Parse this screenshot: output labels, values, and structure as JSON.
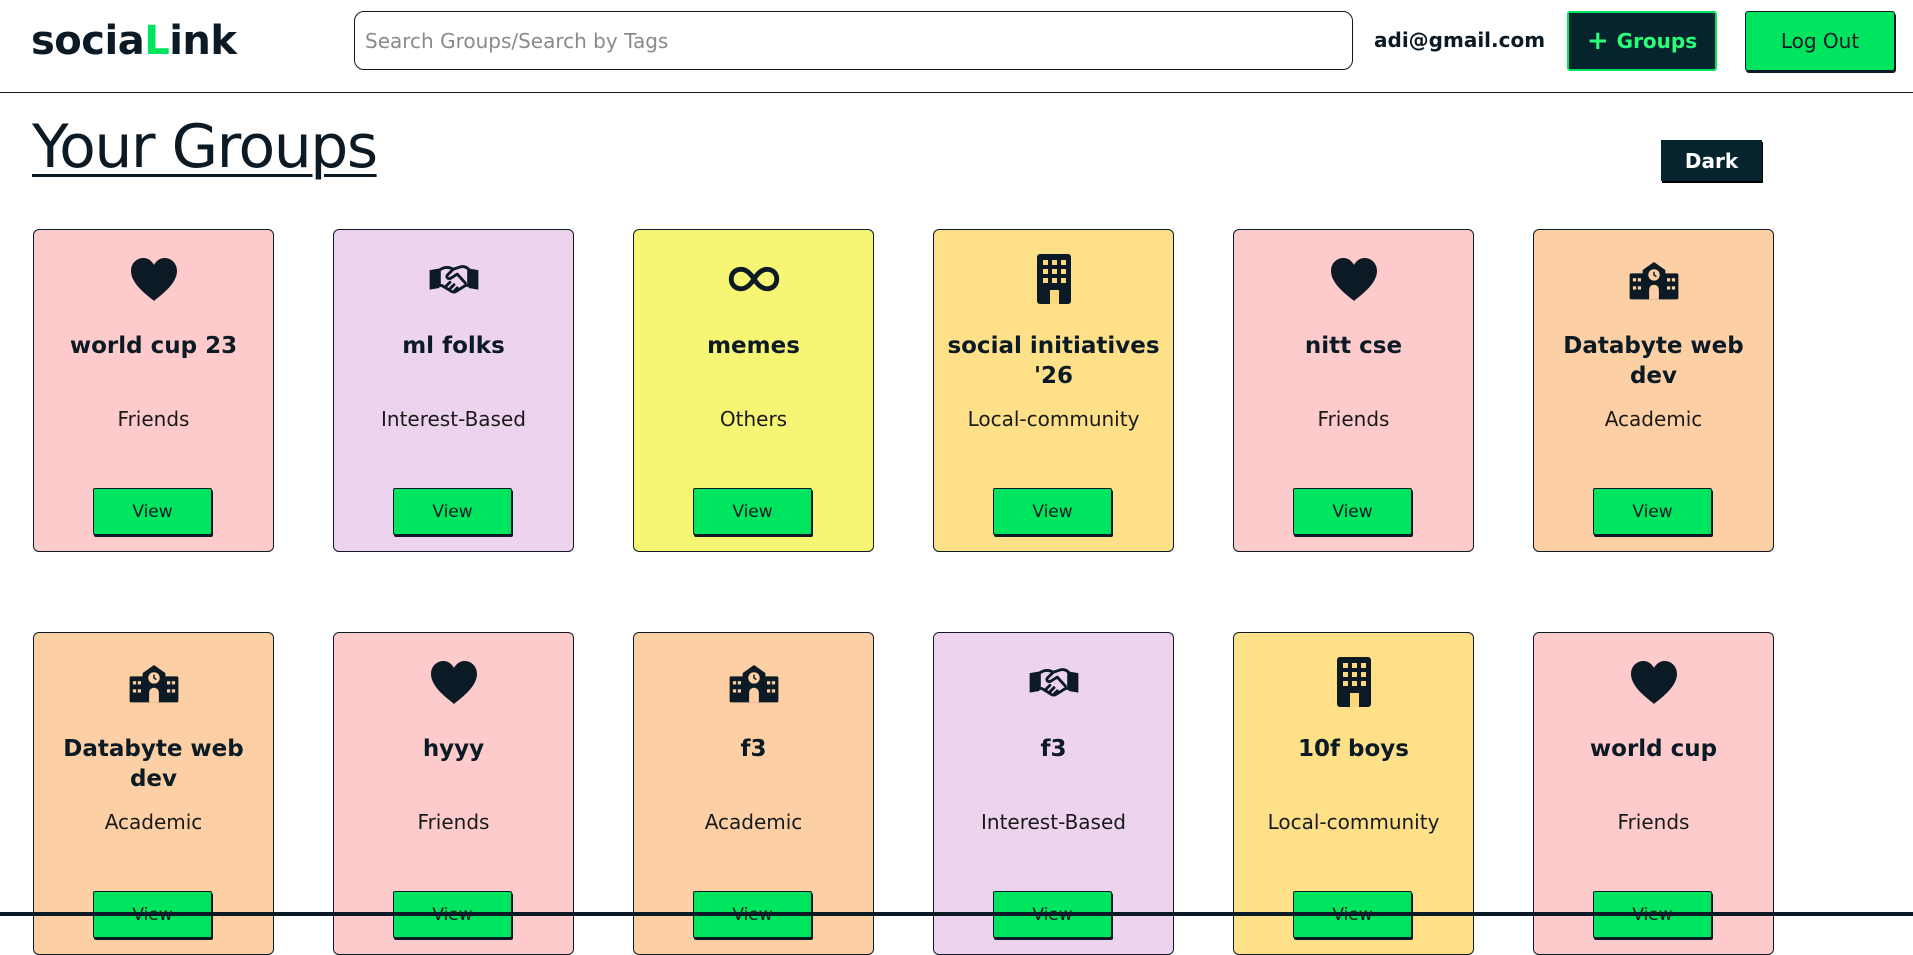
{
  "brand": {
    "prefix": "socia",
    "accent_letter": "L",
    "suffix": "ink",
    "accent_color": "#00e55f"
  },
  "search": {
    "placeholder": "Search Groups/Search by Tags",
    "value": ""
  },
  "user": {
    "email": "adi@gmail.com"
  },
  "nav": {
    "groups_label": "Groups",
    "groups_icon": "plus-icon",
    "logout_label": "Log Out"
  },
  "page": {
    "title": "Your Groups",
    "theme_toggle_label": "Dark"
  },
  "category_colors": {
    "Friends": "#fecbcc",
    "Interest-Based": "#edd3ed",
    "Others": "#f6f674",
    "Local-community": "#fde087",
    "Academic": "#fcd0a4"
  },
  "groups": [
    {
      "name": "world cup 23",
      "category": "Friends",
      "icon": "heart-icon",
      "view_label": "View"
    },
    {
      "name": "ml folks",
      "category": "Interest-Based",
      "icon": "handshake-icon",
      "view_label": "View"
    },
    {
      "name": "memes",
      "category": "Others",
      "icon": "infinity-icon",
      "view_label": "View"
    },
    {
      "name": "social initiatives '26",
      "category": "Local-community",
      "icon": "building-icon",
      "view_label": "View"
    },
    {
      "name": "nitt cse",
      "category": "Friends",
      "icon": "heart-icon",
      "view_label": "View"
    },
    {
      "name": "Databyte web dev",
      "category": "Academic",
      "icon": "school-icon",
      "view_label": "View"
    },
    {
      "name": "Databyte web dev",
      "category": "Academic",
      "icon": "school-icon",
      "view_label": "View"
    },
    {
      "name": "hyyy",
      "category": "Friends",
      "icon": "heart-icon",
      "view_label": "View"
    },
    {
      "name": "f3",
      "category": "Academic",
      "icon": "school-icon",
      "view_label": "View"
    },
    {
      "name": "f3",
      "category": "Interest-Based",
      "icon": "handshake-icon",
      "view_label": "View"
    },
    {
      "name": "10f boys",
      "category": "Local-community",
      "icon": "building-icon",
      "view_label": "View"
    },
    {
      "name": "world cup",
      "category": "Friends",
      "icon": "heart-icon",
      "view_label": "View"
    }
  ]
}
